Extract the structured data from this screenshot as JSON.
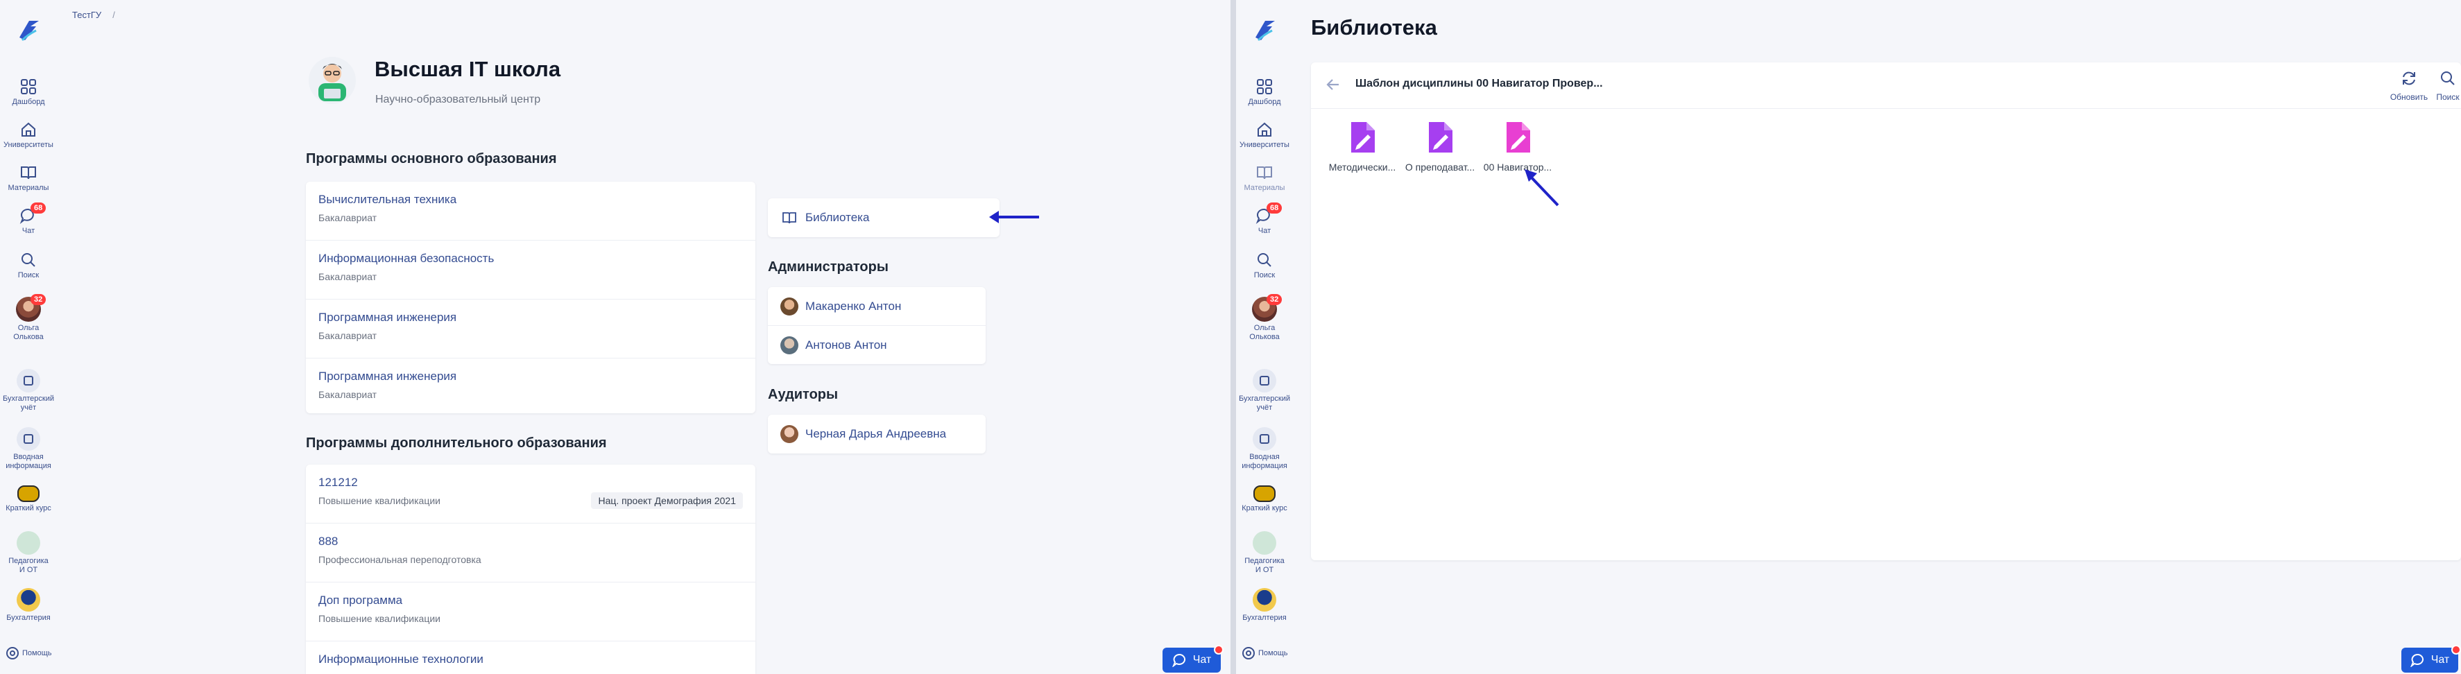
{
  "colors": {
    "accent": "#1f5bd8",
    "link": "#344c91",
    "badge": "#ff3b3b",
    "annotation_arrow": "#1f23c8",
    "file_icon_purple": "#a63ff0",
    "file_icon_pink": "#e83fd2"
  },
  "sidebar": {
    "items": [
      {
        "label": "Дашборд",
        "icon": "grid-icon"
      },
      {
        "label": "Университеты",
        "icon": "home-icon"
      },
      {
        "label": "Материалы",
        "icon": "book-icon"
      },
      {
        "label": "Чат",
        "icon": "chat-icon",
        "badge": "68"
      },
      {
        "label": "Поиск",
        "icon": "search-icon"
      },
      {
        "label": "Ольга Олькова",
        "icon": "user-avatar",
        "badge": "32"
      },
      {
        "label": "Бухгалтерский учёт",
        "icon": "course-icon"
      },
      {
        "label": "Вводная информация",
        "icon": "course-icon"
      },
      {
        "label": "Краткий курс",
        "icon": "course-icon"
      },
      {
        "label": "Педагогика И ОТ",
        "icon": "course-icon"
      },
      {
        "label": "Бухгалтерия",
        "icon": "graduation-cap-icon"
      }
    ],
    "help_label": "Помощь"
  },
  "left": {
    "breadcrumb": {
      "org": "ТестГУ",
      "sep": "/"
    },
    "org_title": "Высшая IT школа",
    "org_subtitle": "Научно-образовательный центр",
    "main_programs_heading": "Программы основного образования",
    "main_programs": [
      {
        "title": "Вычислительная техника",
        "level": "Бакалавриат"
      },
      {
        "title": "Информационная безопасность",
        "level": "Бакалавриат"
      },
      {
        "title": "Программная инженерия",
        "level": "Бакалавриат"
      },
      {
        "title": "Программная инженерия",
        "level": "Бакалавриат"
      }
    ],
    "extra_programs_heading": "Программы дополнительного образования",
    "extra_programs": [
      {
        "title": "121212",
        "level": "Повышение квалификации",
        "tag": "Нац. проект Демография 2021"
      },
      {
        "title": "888",
        "level": "Профессиональная переподготовка",
        "tag": ""
      },
      {
        "title": "Доп программа",
        "level": "Повышение квалификации",
        "tag": ""
      },
      {
        "title": "Информационные технологии",
        "level": "",
        "tag": ""
      }
    ],
    "library_link": "Библиотека",
    "admins_heading": "Администраторы",
    "admins": [
      "Макаренко Антон",
      "Антонов Антон"
    ],
    "auditors_heading": "Аудиторы",
    "auditors": [
      "Черная Дарья Андреевна"
    ],
    "chat_button": "Чат"
  },
  "right": {
    "title": "Библиотека",
    "path": "Шаблон дисциплины 00 Навигатор Провер...",
    "tools": {
      "refresh": "Обновить",
      "search": "Поиск"
    },
    "files": [
      {
        "name": "Методически...",
        "icon": "edit-document-icon"
      },
      {
        "name": "О преподават...",
        "icon": "edit-document-icon"
      },
      {
        "name": "00 Навигатор...",
        "icon": "edit-document-icon"
      }
    ],
    "chat_button": "Чат"
  }
}
